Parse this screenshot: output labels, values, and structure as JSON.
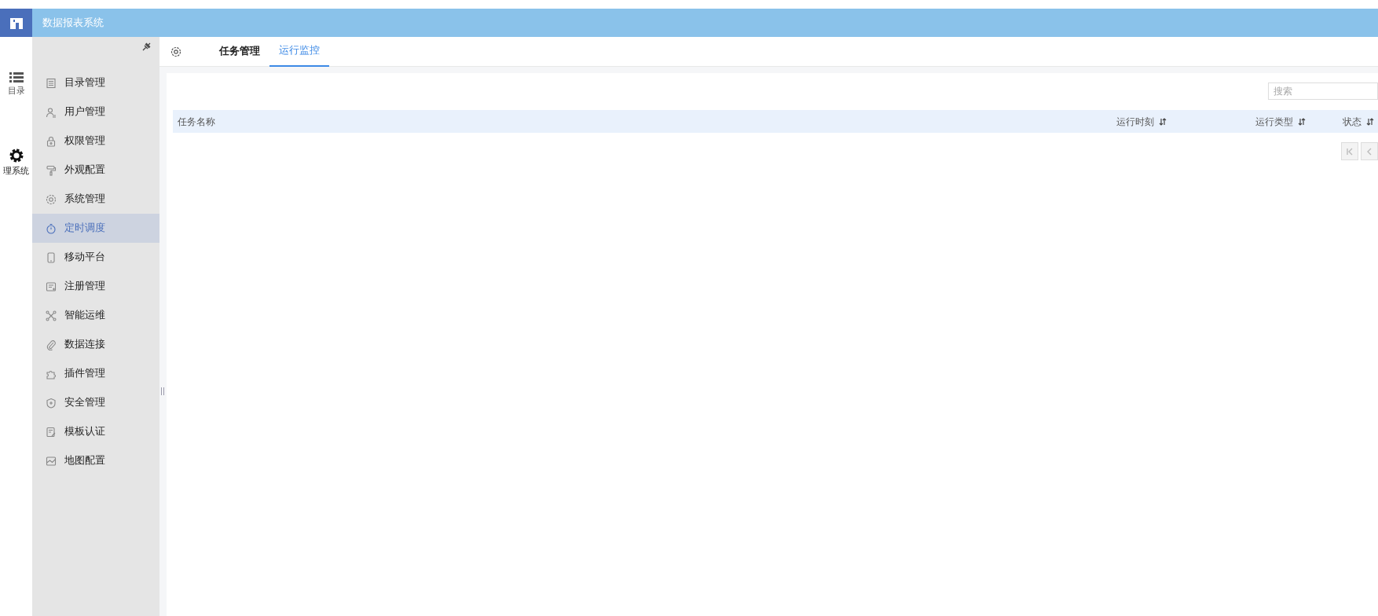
{
  "header": {
    "title": "数据报表系统"
  },
  "rail": {
    "items": [
      {
        "label": "目录",
        "selected": false
      },
      {
        "label": "理系统",
        "selected": true
      }
    ]
  },
  "sidebar": {
    "items": [
      {
        "label": "目录管理",
        "selected": false
      },
      {
        "label": "用户管理",
        "selected": false
      },
      {
        "label": "权限管理",
        "selected": false
      },
      {
        "label": "外观配置",
        "selected": false
      },
      {
        "label": "系统管理",
        "selected": false
      },
      {
        "label": "定时调度",
        "selected": true
      },
      {
        "label": "移动平台",
        "selected": false
      },
      {
        "label": "注册管理",
        "selected": false
      },
      {
        "label": "智能运维",
        "selected": false
      },
      {
        "label": "数据连接",
        "selected": false
      },
      {
        "label": "插件管理",
        "selected": false
      },
      {
        "label": "安全管理",
        "selected": false
      },
      {
        "label": "模板认证",
        "selected": false
      },
      {
        "label": "地图配置",
        "selected": false
      }
    ]
  },
  "tabs": [
    {
      "label": "任务管理",
      "selected": false
    },
    {
      "label": "运行监控",
      "selected": true
    }
  ],
  "search": {
    "placeholder": "搜索"
  },
  "table": {
    "columns": [
      {
        "label": "任务名称",
        "sortable": false
      },
      {
        "label": "运行时刻",
        "sortable": true
      },
      {
        "label": "运行类型",
        "sortable": true
      },
      {
        "label": "状态",
        "sortable": true
      }
    ]
  }
}
